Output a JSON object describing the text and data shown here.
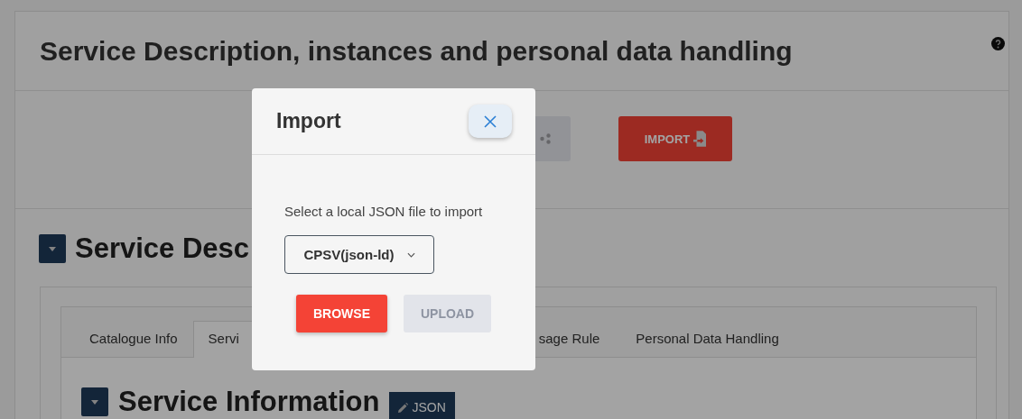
{
  "page": {
    "title": "Service Description, instances and personal data handling"
  },
  "toolbar": {
    "buttons": [
      {
        "kind": "export",
        "disabled": true
      },
      {
        "kind": "import",
        "label": "IMPORT",
        "disabled": false
      }
    ]
  },
  "section": {
    "title": "Service Desc",
    "expanded": true
  },
  "tabs": [
    {
      "label": "Catalogue Info",
      "selected": false
    },
    {
      "label": "Servi",
      "selected": true
    },
    {
      "label": "sage Rule",
      "selected": false
    },
    {
      "label": "Personal Data Handling",
      "selected": false
    }
  ],
  "subsection": {
    "title": "Service Information",
    "expanded": true,
    "badge": "JSON"
  },
  "dialog": {
    "title": "Import",
    "message": "Select a local JSON file to import",
    "format": "CPSV(json-ld)",
    "buttons": [
      {
        "label": "BROWSE",
        "disabled": false
      },
      {
        "label": "UPLOAD",
        "disabled": true
      }
    ]
  }
}
